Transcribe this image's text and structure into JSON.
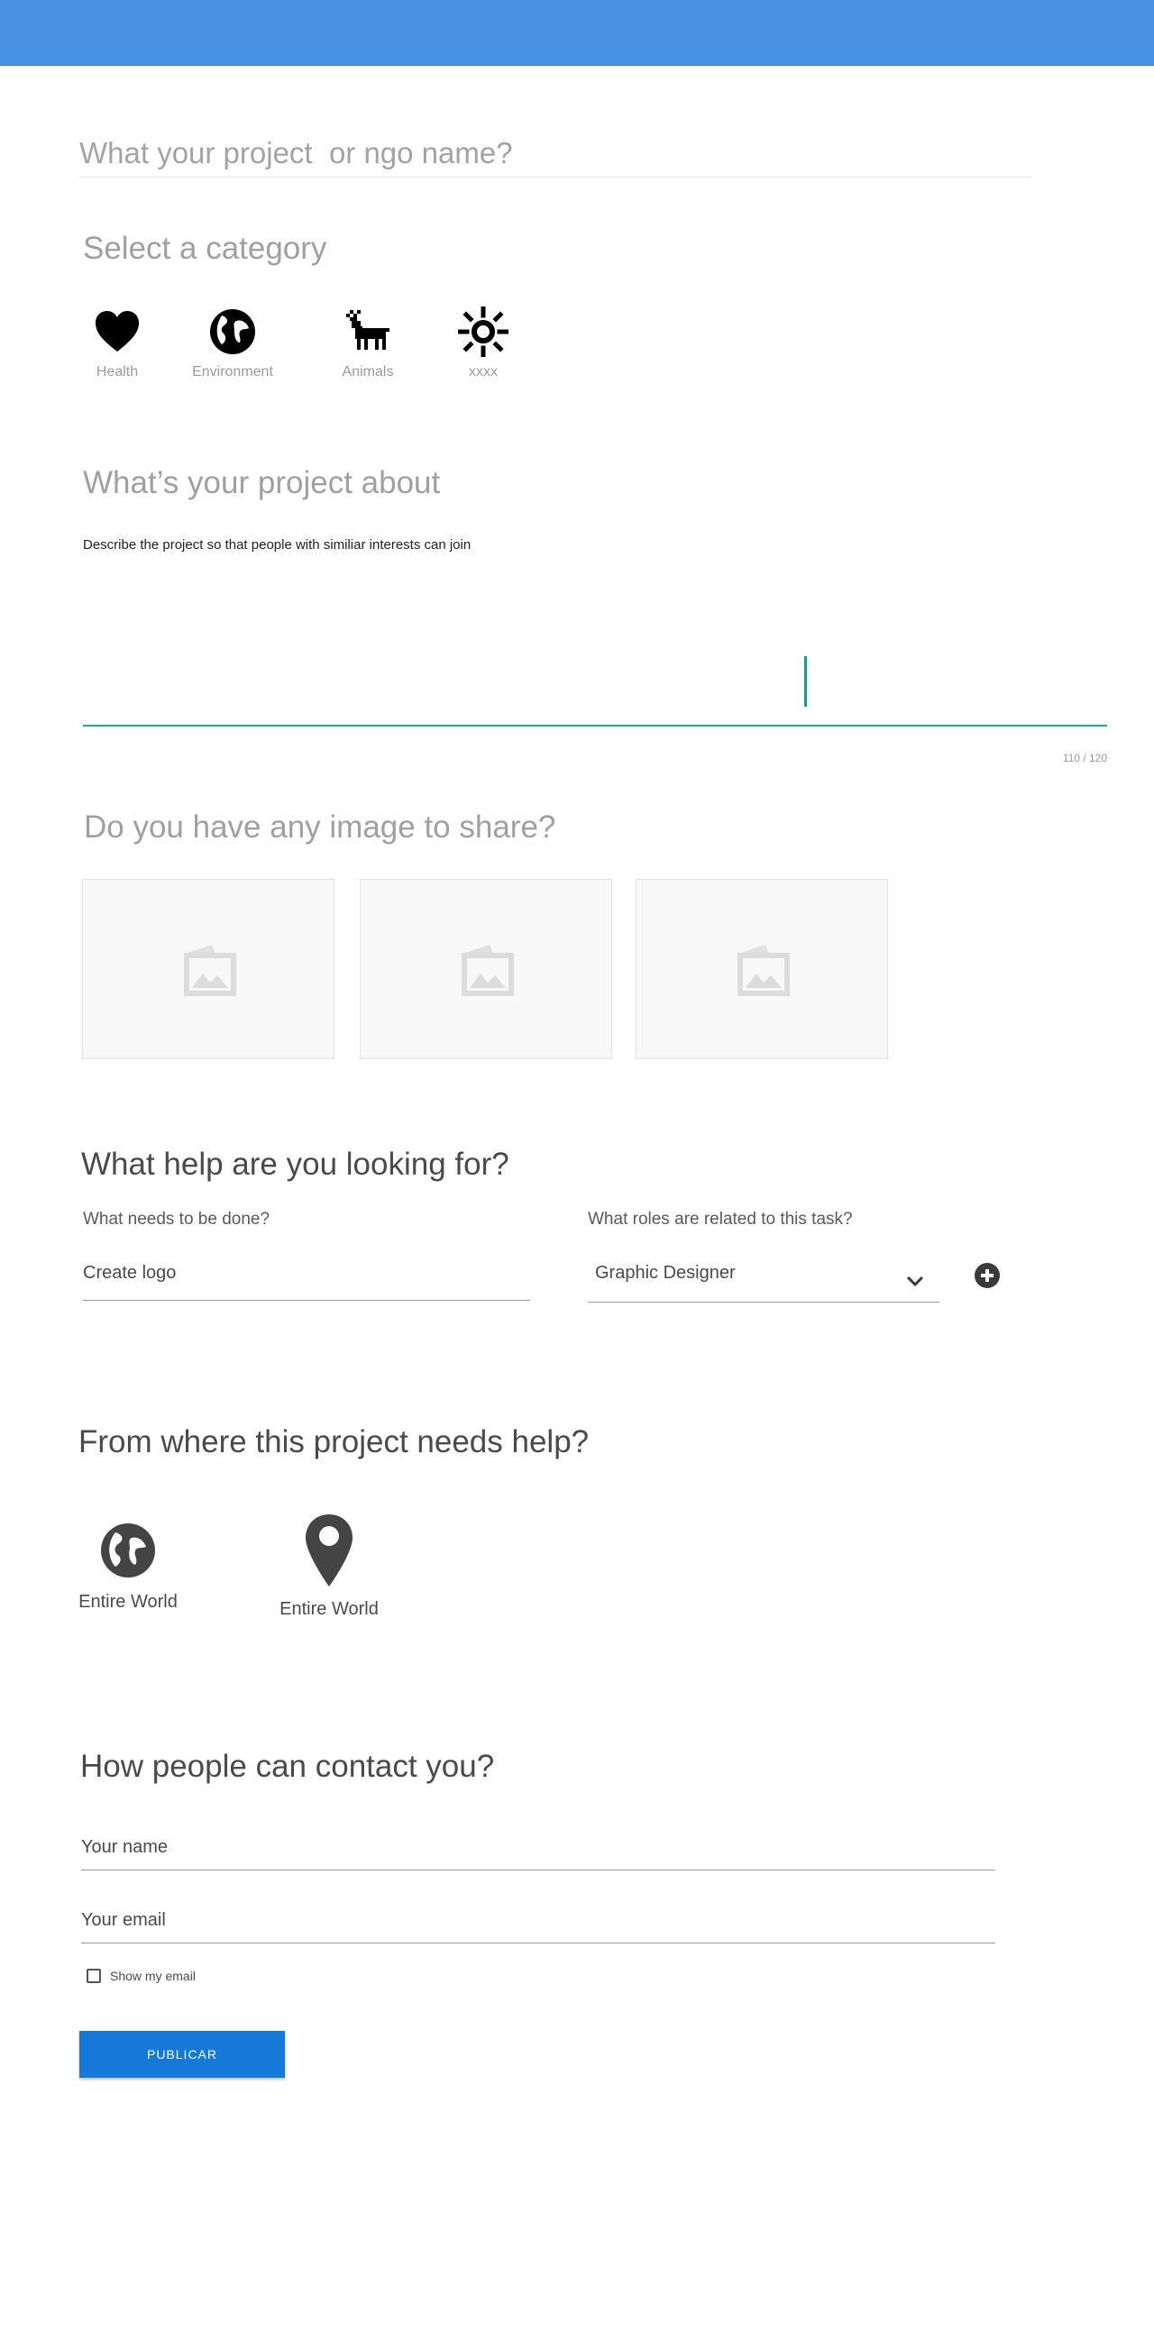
{
  "header": {
    "color": "#4a90e2"
  },
  "project": {
    "name_placeholder": "What your project  or ngo name?"
  },
  "category": {
    "title": "Select a category",
    "items": [
      {
        "label": "Health",
        "icon": "heart-icon"
      },
      {
        "label": "Environment",
        "icon": "globe-icon"
      },
      {
        "label": "Animals",
        "icon": "deer-icon"
      },
      {
        "label": "xxxx",
        "icon": "sun-icon"
      }
    ]
  },
  "about": {
    "title": "What’s your project about",
    "description": "Describe the project so that people with similiar interests can join",
    "counter": "110 / 120"
  },
  "images": {
    "title": "Do you have any image to share?",
    "icon": "image-placeholder-icon"
  },
  "help": {
    "title": "What help are you looking for?",
    "task_label": "What needs to be done?",
    "task_value": "Create logo",
    "roles_label": "What roles are related to this task?",
    "roles_value": "Graphic Designer"
  },
  "location": {
    "title": "From where this project needs help?",
    "items": [
      {
        "label": "Entire World",
        "icon": "globe-icon"
      },
      {
        "label": "Entire World",
        "icon": "map-pin-icon"
      }
    ]
  },
  "contact": {
    "title": "How people can contact you?",
    "name_placeholder": "Your name",
    "email_placeholder": "Your email",
    "show_email_label": "Show my email"
  },
  "actions": {
    "publish_label": "PUBLICAR",
    "publish_color": "#1479d9"
  }
}
